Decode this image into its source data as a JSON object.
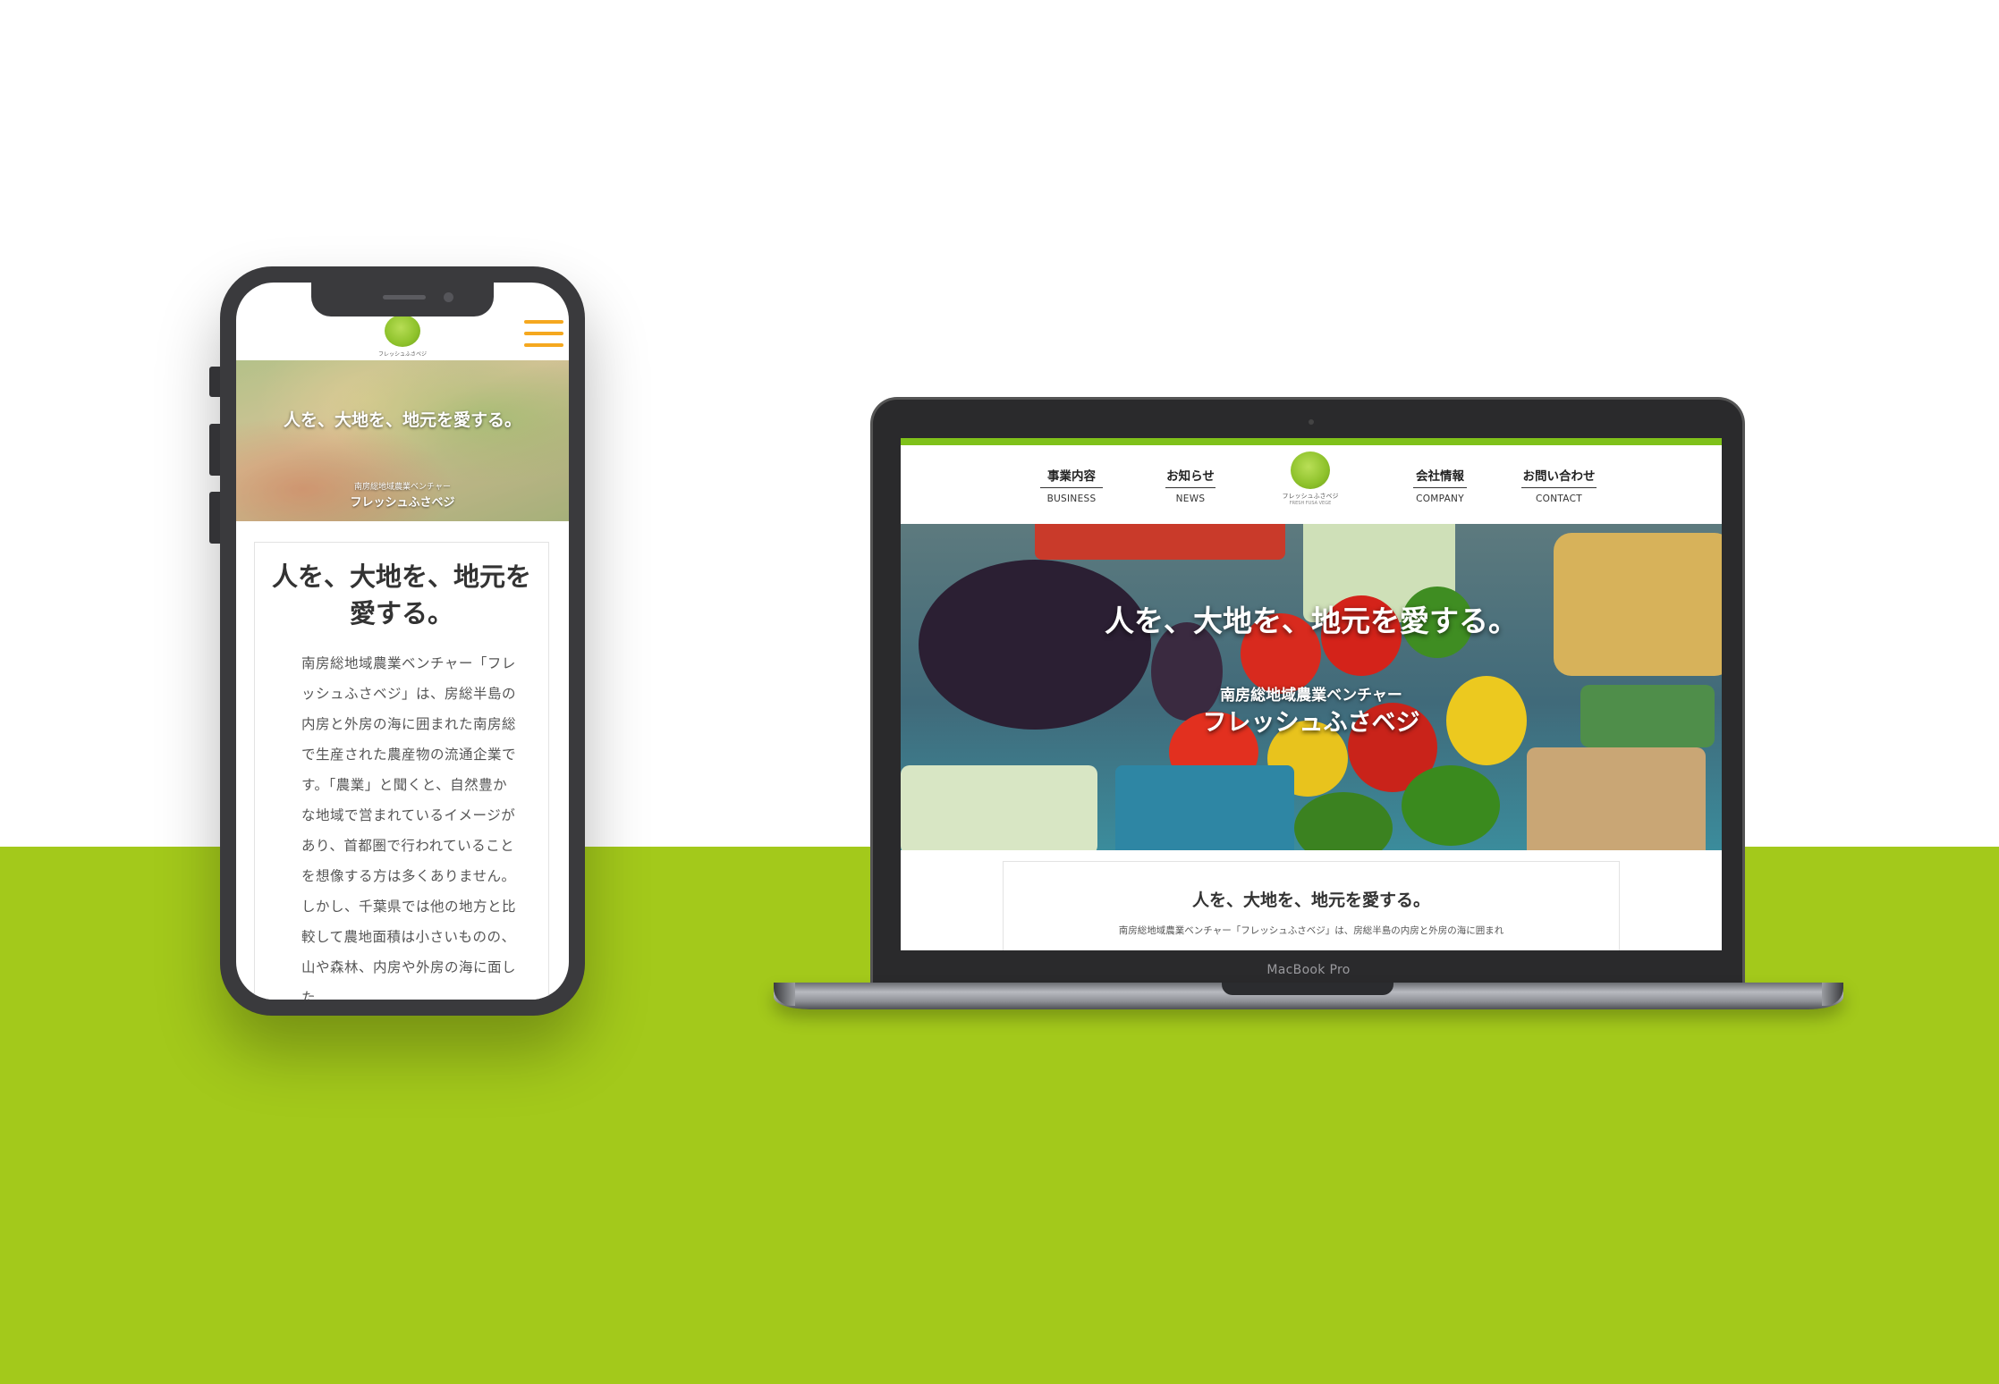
{
  "mobile": {
    "logo_text": "フレッシュふさベジ",
    "hero": {
      "title": "人を、大地を、地元を愛する。",
      "subtitle": "南房総地域農業ベンチャー",
      "brand": "フレッシュふさベジ"
    },
    "card": {
      "title": "人を、大地を、地元を愛する。",
      "body": "南房総地域農業ベンチャー「フレッシュふさベジ」は、房総半島の内房と外房の海に囲まれた南房総で生産された農産物の流通企業です。「農業」と聞くと、自然豊かな地域で営まれているイメージがあり、首都圏で行われていることを想像する方は多くありません。しかし、千葉県では他の地方と比較して農地面積は小さいものの、山や森林、内房や外房の海に面した"
    }
  },
  "desktop": {
    "nav": [
      {
        "ja": "事業内容",
        "en": "BUSINESS"
      },
      {
        "ja": "お知らせ",
        "en": "NEWS"
      },
      {
        "ja": "会社情報",
        "en": "COMPANY"
      },
      {
        "ja": "お問い合わせ",
        "en": "CONTACT"
      }
    ],
    "logo_text": "フレッシュふさベジ",
    "logo_subtext": "FRESH FUSA VEGE",
    "hero": {
      "title": "人を、大地を、地元を愛する。",
      "subtitle": "南房総地域農業ベンチャー",
      "brand": "フレッシュふさベジ"
    },
    "card": {
      "title": "人を、大地を、地元を愛する。",
      "body": "南房総地域農業ベンチャー「フレッシュふさベジ」は、房総半島の内房と外房の海に囲まれ"
    }
  },
  "device_label": "MacBook Pro",
  "colors": {
    "brand_green": "#a3c91b",
    "header_bar_green": "#7fc11a",
    "menu_orange": "#f5a81f"
  },
  "icons": {
    "menu": "hamburger-icon",
    "logo": "cabbage-logo-icon"
  }
}
